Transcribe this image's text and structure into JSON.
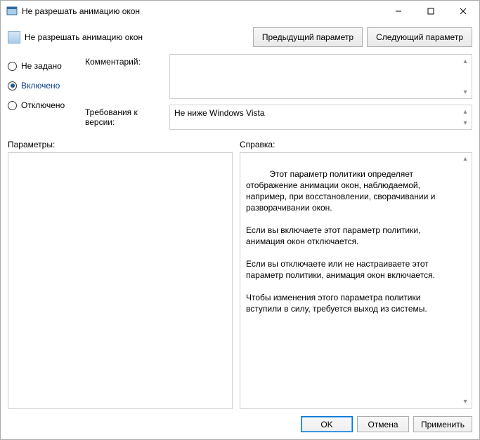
{
  "titlebar": {
    "title": "Не разрешать анимацию окон"
  },
  "header": {
    "title": "Не разрешать анимацию окон",
    "prev_btn": "Предыдущий параметр",
    "next_btn": "Следующий параметр"
  },
  "radios": {
    "not_configured": "Не задано",
    "enabled": "Включено",
    "disabled": "Отключено",
    "selected": "enabled"
  },
  "fields": {
    "comment_label": "Комментарий:",
    "comment_value": "",
    "req_label": "Требования к версии:",
    "req_value": "Не ниже Windows Vista"
  },
  "columns": {
    "params_label": "Параметры:",
    "params_content": "",
    "help_label": "Справка:",
    "help_content": "Этот параметр политики определяет отображение анимации окон, наблюдаемой, например, при восстановлении, сворачивании и разворачивании окон.\n\nЕсли вы включаете этот параметр политики, анимация окон отключается.\n\nЕсли вы отключаете или не настраиваете этот параметр политики, анимация окон включается.\n\nЧтобы изменения этого параметра политики вступили в силу, требуется выход из системы."
  },
  "footer": {
    "ok": "OK",
    "cancel": "Отмена",
    "apply": "Применить"
  }
}
